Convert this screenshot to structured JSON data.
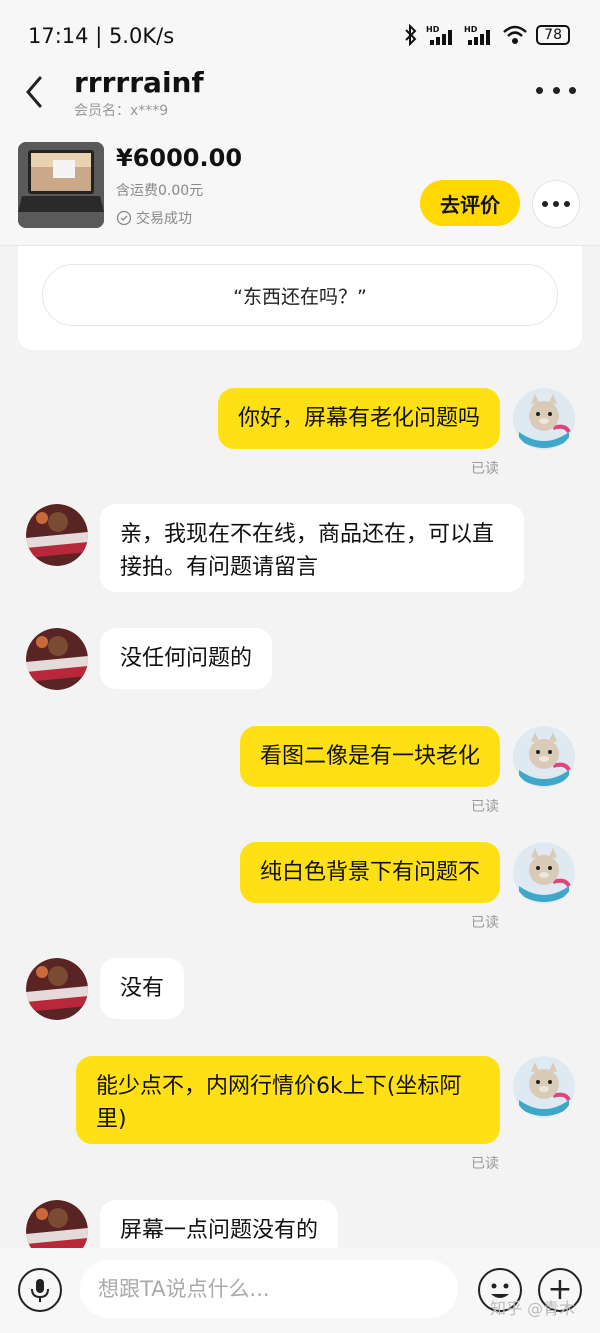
{
  "status": {
    "time": "17:14 | 5.0K/s",
    "battery": "78"
  },
  "header": {
    "title": "rrrrrainf",
    "member": "会员名：x***9"
  },
  "product": {
    "price": "¥6000.00",
    "shipping": "含运费0.00元",
    "deal_status": "交易成功",
    "review_label": "去评价"
  },
  "chat": {
    "quote": "“东西还在吗？”",
    "read_label": "已读",
    "messages": [
      {
        "from": "me",
        "text": "你好，屏幕有老化问题吗",
        "read": true
      },
      {
        "from": "them",
        "text": "亲，我现在不在线，商品还在，可以直接拍。有问题请留言"
      },
      {
        "from": "them",
        "text": "没任何问题的"
      },
      {
        "from": "me",
        "text": "看图二像是有一块老化",
        "read": true
      },
      {
        "from": "me",
        "text": "纯白色背景下有问题不",
        "read": true
      },
      {
        "from": "them",
        "text": "没有"
      },
      {
        "from": "me",
        "text": "能少点不，内网行情价6k上下(坐标阿里)",
        "read": true
      },
      {
        "from": "them",
        "text": "屏幕一点问题没有的"
      }
    ]
  },
  "input": {
    "placeholder": "想跟TA说点什么..."
  },
  "watermark": "知乎 @青木",
  "colors": {
    "accent": "#ffe014",
    "background": "#f3f3f3"
  }
}
